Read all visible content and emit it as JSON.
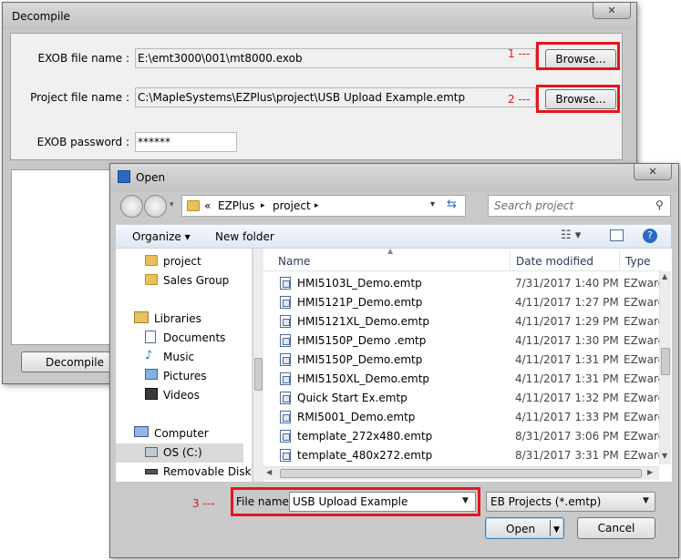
{
  "decompile": {
    "title": "Decompile",
    "close": "✕",
    "exob_label": "EXOB file name :",
    "exob_value": "E:\\emt3000\\001\\mt8000.exob",
    "project_label": "Project file name :",
    "project_value": "C:\\MapleSystems\\EZPlus\\project\\USB Upload Example.emtp",
    "password_label": "EXOB password :",
    "password_value": "******",
    "browse1": "Browse...",
    "browse2": "Browse...",
    "decompile_button": "Decompile"
  },
  "annotations": {
    "a1": "1 ---",
    "a2": "2 ---",
    "a3": "3 ---"
  },
  "open": {
    "title": "Open",
    "close": "✕",
    "path": {
      "sep0": "«",
      "seg1": "EZPlus",
      "seg2": "project"
    },
    "search_placeholder": "Search project",
    "organize": "Organize ▾",
    "new_folder": "New folder",
    "nav": {
      "project": "project",
      "sales": "Sales Group",
      "libraries": "Libraries",
      "documents": "Documents",
      "music": "Music",
      "pictures": "Pictures",
      "videos": "Videos",
      "computer": "Computer",
      "os": "OS (C:)",
      "removable": "Removable Disk ("
    },
    "columns": {
      "name": "Name",
      "date": "Date modified",
      "type": "Type"
    },
    "files": [
      {
        "name": "HMI5103L_Demo.emtp",
        "date": "7/31/2017 1:40 PM",
        "type": "EZware"
      },
      {
        "name": "HMI5121P_Demo.emtp",
        "date": "4/11/2017 1:27 PM",
        "type": "EZware"
      },
      {
        "name": "HMI5121XL_Demo.emtp",
        "date": "4/11/2017 1:29 PM",
        "type": "EZware"
      },
      {
        "name": "HMI5150P_Demo .emtp",
        "date": "4/11/2017 1:30 PM",
        "type": "EZware"
      },
      {
        "name": "HMI5150P_Demo.emtp",
        "date": "4/11/2017 1:31 PM",
        "type": "EZware"
      },
      {
        "name": "HMI5150XL_Demo.emtp",
        "date": "4/11/2017 1:31 PM",
        "type": "EZware"
      },
      {
        "name": "Quick Start Ex.emtp",
        "date": "4/11/2017 1:32 PM",
        "type": "EZware"
      },
      {
        "name": "RMI5001_Demo.emtp",
        "date": "4/11/2017 1:33 PM",
        "type": "EZware"
      },
      {
        "name": "template_272x480.emtp",
        "date": "8/31/2017 3:06 PM",
        "type": "EZware"
      },
      {
        "name": "template_480x272.emtp",
        "date": "8/31/2017 3:31 PM",
        "type": "EZware"
      }
    ],
    "filename_label": "File name:",
    "filename_value": "USB Upload Example",
    "filetype_value": "EB Projects (*.emtp)",
    "open_button": "Open",
    "cancel_button": "Cancel"
  }
}
